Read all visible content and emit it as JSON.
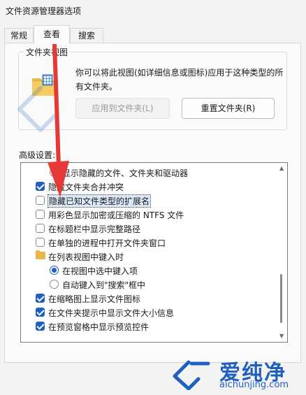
{
  "window": {
    "title": "文件资源管理器选项"
  },
  "tabs": [
    {
      "label": "常规"
    },
    {
      "label": "查看"
    },
    {
      "label": "搜索"
    }
  ],
  "folder_views": {
    "group_label": "文件夹视图",
    "description": "你可以将此视图(如详细信息或图标)应用于这种类型的所有文件夹。",
    "apply_button": "应用到文件夹(L)",
    "reset_button": "重置文件夹(R)"
  },
  "advanced": {
    "label": "高级设置:",
    "items": [
      {
        "type": "radio",
        "checked": false,
        "indent": 1,
        "label": "显示隐藏的文件、文件夹和驱动器"
      },
      {
        "type": "checkbox",
        "checked": true,
        "indent": 0,
        "label": "隐藏文件夹合并冲突"
      },
      {
        "type": "checkbox",
        "checked": false,
        "indent": 0,
        "label": "隐藏已知文件类型的扩展名",
        "selected": true
      },
      {
        "type": "checkbox",
        "checked": false,
        "indent": 0,
        "label": "用彩色显示加密或压缩的 NTFS 文件"
      },
      {
        "type": "checkbox",
        "checked": false,
        "indent": 0,
        "label": "在标题栏中显示完整路径"
      },
      {
        "type": "checkbox",
        "checked": false,
        "indent": 0,
        "label": "在单独的进程中打开文件夹窗口"
      },
      {
        "type": "folder",
        "checked": false,
        "indent": 0,
        "label": "在列表视图中键入时"
      },
      {
        "type": "radio",
        "checked": true,
        "indent": 1,
        "label": "在视图中选中键入项"
      },
      {
        "type": "radio",
        "checked": false,
        "indent": 1,
        "label": "自动键入到\"搜索\"框中"
      },
      {
        "type": "checkbox",
        "checked": true,
        "indent": 0,
        "label": "在缩略图上显示文件图标"
      },
      {
        "type": "checkbox",
        "checked": true,
        "indent": 0,
        "label": "在文件夹提示中显示文件大小信息"
      },
      {
        "type": "checkbox",
        "checked": true,
        "indent": 0,
        "label": "在预览窗格中显示预览控件"
      }
    ]
  },
  "logo": {
    "name": "爱纯净",
    "url": "aichunjing.com"
  },
  "colors": {
    "accent": "#1f5fbf",
    "arrow": "#e53935",
    "panel": "#fbfbfb"
  },
  "icons": [
    "folder-icon",
    "checkbox-icon",
    "radio-icon",
    "scroll-up-icon",
    "scroll-down-icon"
  ]
}
